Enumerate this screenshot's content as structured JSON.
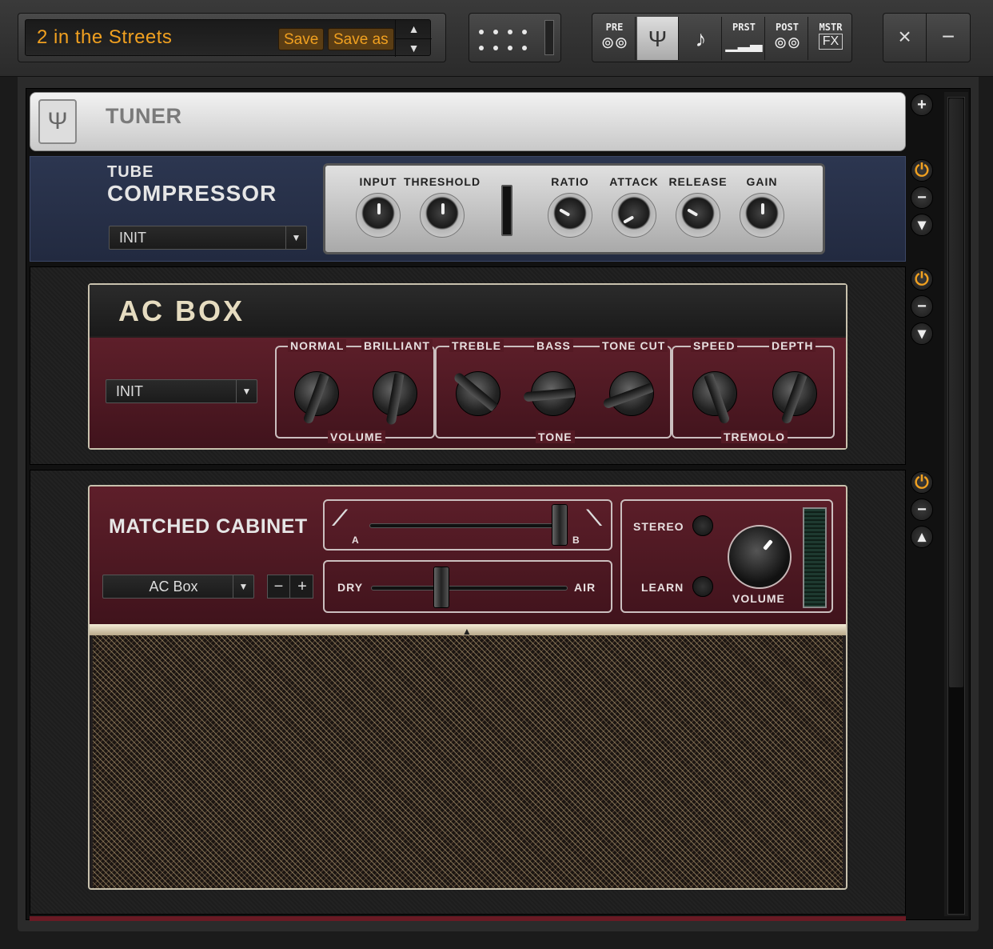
{
  "preset": {
    "name": "2 in the Streets",
    "save": "Save",
    "save_as": "Save as",
    "up": "▲",
    "down": "▼"
  },
  "fx_buttons": [
    {
      "label": "PRE",
      "glyph": "⊚⊚"
    },
    {
      "label": "",
      "glyph": "Ψ"
    },
    {
      "label": "",
      "glyph": "♪"
    },
    {
      "label": "PRST",
      "glyph": "▁▂▃"
    },
    {
      "label": "POST",
      "glyph": "⊚⊚"
    },
    {
      "label": "MSTR",
      "glyph": "FX"
    }
  ],
  "window": {
    "close": "×",
    "minimize": "−"
  },
  "tuner": {
    "title": "TUNER",
    "icon": "tuning-fork-icon",
    "glyph": "Ψ"
  },
  "compressor": {
    "title1": "TUBE",
    "title2": "COMPRESSOR",
    "preset": "INIT",
    "knobs": [
      {
        "label": "INPUT"
      },
      {
        "label": "THRESHOLD"
      },
      {
        "label": "RATIO"
      },
      {
        "label": "ATTACK"
      },
      {
        "label": "RELEASE"
      },
      {
        "label": "GAIN"
      }
    ]
  },
  "acbox": {
    "title": "AC BOX",
    "preset": "INIT",
    "labels": {
      "normal": "NORMAL",
      "brilliant": "BRILLIANT",
      "volume": "VOLUME",
      "treble": "TREBLE",
      "bass": "BASS",
      "tone_cut": "TONE CUT",
      "tone": "TONE",
      "speed": "SPEED",
      "depth": "DEPTH",
      "tremolo": "TREMOLO"
    }
  },
  "cabinet": {
    "title": "MATCHED CABINET",
    "preset": "AC Box",
    "minus": "−",
    "plus": "+",
    "mic_a": "A",
    "mic_b": "B",
    "dry": "DRY",
    "air": "AIR",
    "stereo": "STEREO",
    "learn": "LEARN",
    "volume": "VOLUME"
  },
  "side": {
    "power": "⏻",
    "remove": "−",
    "down": "▾",
    "up": "▴",
    "add": "+"
  },
  "colors": {
    "accent": "#f0a020",
    "amp_red": "#5e1f2a",
    "comp_blue": "#2c3650"
  }
}
